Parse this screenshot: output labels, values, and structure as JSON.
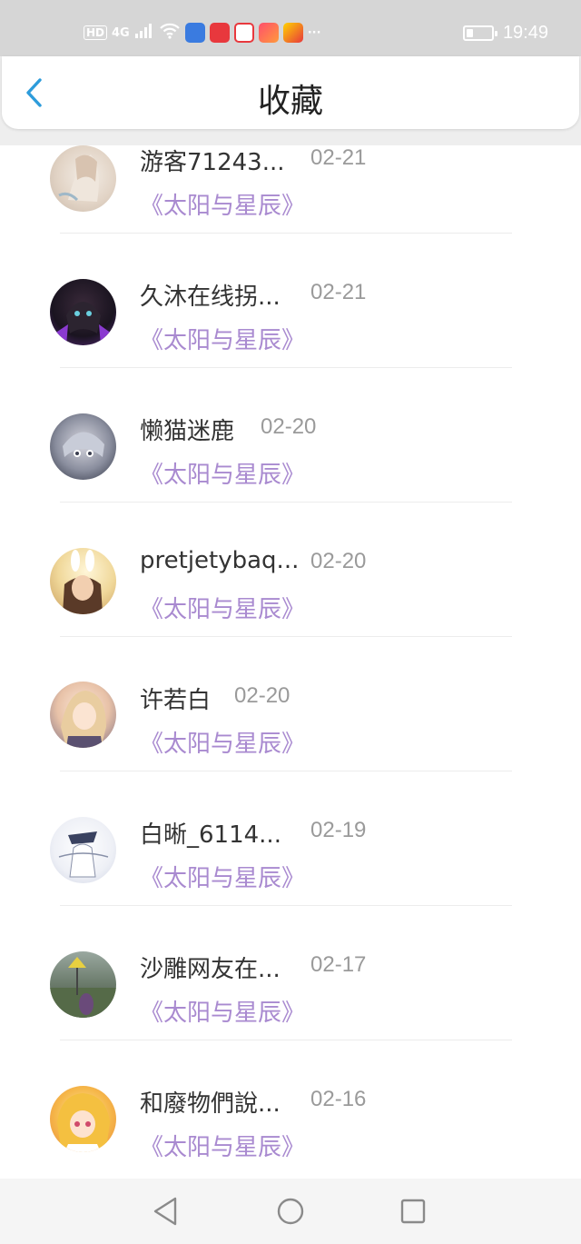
{
  "status_bar": {
    "hd": "HD",
    "network": "4G",
    "time": "19:49",
    "more": "···",
    "battery_level": 0.25
  },
  "header": {
    "title": "收藏"
  },
  "list": [
    {
      "user": "游客71243...",
      "date": "02-21",
      "book": "《太阳与星辰》"
    },
    {
      "user": "久沐在线拐...",
      "date": "02-21",
      "book": "《太阳与星辰》"
    },
    {
      "user": "懒猫迷鹿",
      "date": "02-20",
      "book": "《太阳与星辰》"
    },
    {
      "user": "pretjetybaq...",
      "date": "02-20",
      "book": "《太阳与星辰》"
    },
    {
      "user": "许若白",
      "date": "02-20",
      "book": "《太阳与星辰》"
    },
    {
      "user": "白晰_6114...",
      "date": "02-19",
      "book": "《太阳与星辰》"
    },
    {
      "user": "沙雕网友在...",
      "date": "02-17",
      "book": "《太阳与星辰》"
    },
    {
      "user": "和廢物們說...",
      "date": "02-16",
      "book": "《太阳与星辰》"
    }
  ],
  "colors": {
    "accent": "#2d9cdb",
    "book_title": "#a98ad0",
    "date": "#9a9a9a"
  }
}
